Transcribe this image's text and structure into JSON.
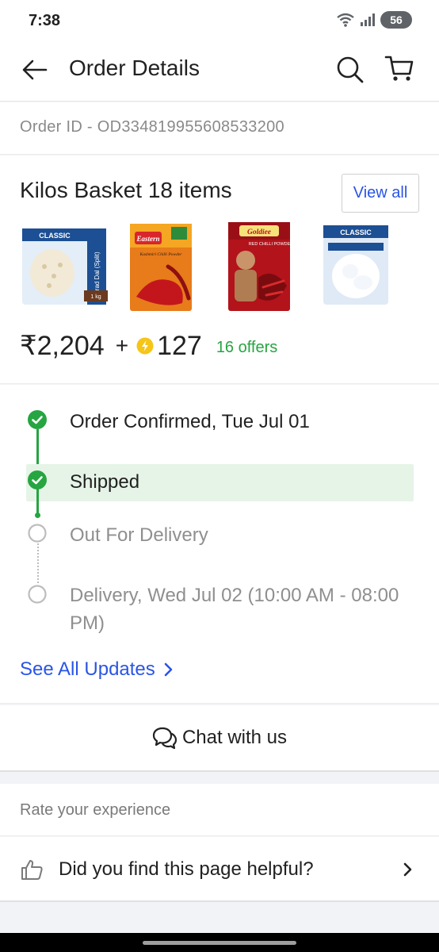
{
  "status_bar": {
    "time": "7:38",
    "battery": "56",
    "network": "6"
  },
  "header": {
    "title": "Order Details"
  },
  "order": {
    "id_text": "Order ID - OD334819955608533200"
  },
  "basket": {
    "title": "Kilos Basket 18 items",
    "view_all_label": "View all",
    "products": [
      {
        "brand": "CLASSIC",
        "name": "Urad Dal (Split)",
        "pack": "1 kg"
      },
      {
        "brand": "Eastern",
        "name": "Kashmiri Chilli Powder",
        "pack": ""
      },
      {
        "brand": "Goldiee",
        "name": "RED CHILLI POWDER",
        "pack": ""
      },
      {
        "brand": "CLASSIC",
        "name": "",
        "pack": ""
      }
    ],
    "price": "₹2,204",
    "plus": "+",
    "coins": "127",
    "offers": "16 offers"
  },
  "tracking": {
    "steps": [
      {
        "label": "Order Confirmed, Tue Jul 01",
        "status": "done"
      },
      {
        "label": "Shipped",
        "status": "done"
      },
      {
        "label": "Out For Delivery",
        "status": "pending"
      },
      {
        "label": "Delivery, Wed Jul 02 (10:00 AM - 08:00 PM)",
        "status": "pending"
      }
    ],
    "see_all_label": "See All Updates"
  },
  "chat": {
    "label": "Chat with us"
  },
  "rating": {
    "label": "Rate your experience",
    "helpful_question": "Did you find this page helpful?"
  },
  "colors": {
    "accent": "#2a55e5",
    "success": "#26a541",
    "highlight": "#e6f4e7",
    "coin": "#f5c518"
  },
  "icons": [
    "back-arrow-icon",
    "search-icon",
    "cart-icon",
    "coin-icon",
    "check-icon",
    "chevron-right-icon",
    "chat-icon",
    "thumbs-up-icon"
  ]
}
